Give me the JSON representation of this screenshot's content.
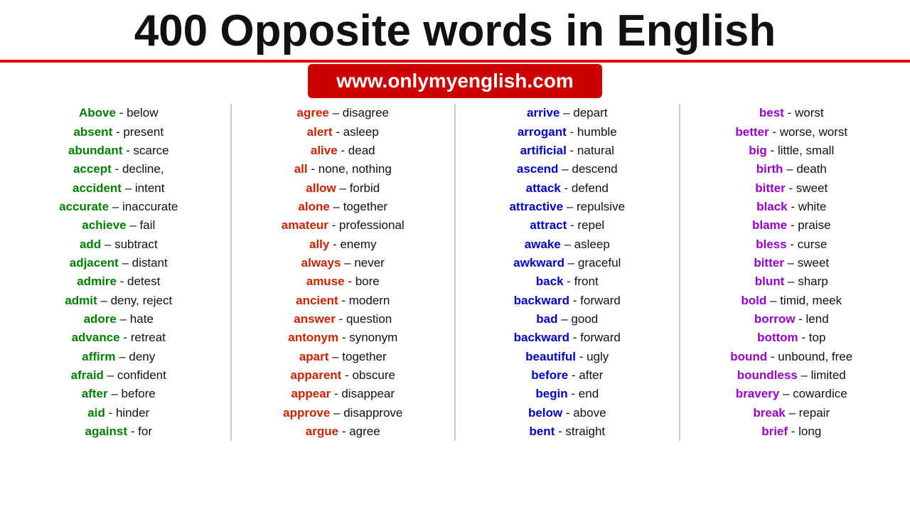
{
  "header": {
    "title": "400 Opposite words in English",
    "url": "www.onlymyenglish.com"
  },
  "columns": [
    {
      "color_class": "col1-key",
      "entries": [
        {
          "key": "Above",
          "sep": " - ",
          "val": "below"
        },
        {
          "key": "absent",
          "sep": " - ",
          "val": "present"
        },
        {
          "key": "abundant",
          "sep": " - ",
          "val": "scarce"
        },
        {
          "key": "accept",
          "sep": " - ",
          "val": "decline,"
        },
        {
          "key": "accident",
          "sep": " – ",
          "val": "intent"
        },
        {
          "key": "accurate",
          "sep": " – ",
          "val": "inaccurate"
        },
        {
          "key": "achieve",
          "sep": " – ",
          "val": "fail"
        },
        {
          "key": "add",
          "sep": " – ",
          "val": "subtract"
        },
        {
          "key": "adjacent",
          "sep": " – ",
          "val": "distant"
        },
        {
          "key": "admire",
          "sep": " - ",
          "val": "detest"
        },
        {
          "key": "admit",
          "sep": " – ",
          "val": "deny, reject"
        },
        {
          "key": "adore",
          "sep": " – ",
          "val": "hate"
        },
        {
          "key": "advance",
          "sep": " - ",
          "val": "retreat"
        },
        {
          "key": "affirm",
          "sep": " – ",
          "val": "deny"
        },
        {
          "key": "afraid",
          "sep": " – ",
          "val": "confident"
        },
        {
          "key": "after",
          "sep": " – ",
          "val": "before"
        },
        {
          "key": "aid",
          "sep": " - ",
          "val": "hinder"
        },
        {
          "key": "against",
          "sep": " - ",
          "val": "for"
        }
      ]
    },
    {
      "color_class": "col2-key",
      "entries": [
        {
          "key": "agree",
          "sep": " – ",
          "val": "disagree"
        },
        {
          "key": "alert",
          "sep": " - ",
          "val": "asleep"
        },
        {
          "key": "alive",
          "sep": " - ",
          "val": "dead"
        },
        {
          "key": "all",
          "sep": " - ",
          "val": "none, nothing"
        },
        {
          "key": "allow",
          "sep": " – ",
          "val": "forbid"
        },
        {
          "key": "alone",
          "sep": " – ",
          "val": "together"
        },
        {
          "key": "amateur",
          "sep": " - ",
          "val": "professional"
        },
        {
          "key": "ally",
          "sep": " - ",
          "val": "enemy"
        },
        {
          "key": "always",
          "sep": " – ",
          "val": "never"
        },
        {
          "key": "amuse",
          "sep": " - ",
          "val": "bore"
        },
        {
          "key": "ancient",
          "sep": " - ",
          "val": "modern"
        },
        {
          "key": "answer",
          "sep": " - ",
          "val": "question"
        },
        {
          "key": "antonym",
          "sep": " - ",
          "val": "synonym"
        },
        {
          "key": "apart",
          "sep": " – ",
          "val": "together"
        },
        {
          "key": "apparent",
          "sep": " - ",
          "val": "obscure"
        },
        {
          "key": "appear",
          "sep": " - ",
          "val": "disappear"
        },
        {
          "key": "approve",
          "sep": " – ",
          "val": "disapprove"
        },
        {
          "key": "argue",
          "sep": " - ",
          "val": "agree"
        }
      ]
    },
    {
      "color_class": "col3-key",
      "entries": [
        {
          "key": "arrive",
          "sep": " – ",
          "val": "depart"
        },
        {
          "key": "arrogant",
          "sep": " - ",
          "val": "humble"
        },
        {
          "key": "artificial",
          "sep": " - ",
          "val": "natural"
        },
        {
          "key": "ascend",
          "sep": " – ",
          "val": "descend"
        },
        {
          "key": "attack",
          "sep": " - ",
          "val": "defend"
        },
        {
          "key": "attractive",
          "sep": " – ",
          "val": "repulsive"
        },
        {
          "key": "attract",
          "sep": " - ",
          "val": "repel"
        },
        {
          "key": "awake",
          "sep": " – ",
          "val": "asleep"
        },
        {
          "key": "awkward",
          "sep": " – ",
          "val": "graceful"
        },
        {
          "key": "back",
          "sep": " - ",
          "val": "front"
        },
        {
          "key": "backward",
          "sep": " - ",
          "val": "forward"
        },
        {
          "key": "bad",
          "sep": " – ",
          "val": "good"
        },
        {
          "key": "backward",
          "sep": " - ",
          "val": "forward"
        },
        {
          "key": "beautiful",
          "sep": " - ",
          "val": "ugly"
        },
        {
          "key": "before",
          "sep": " - ",
          "val": "after"
        },
        {
          "key": "begin",
          "sep": " - ",
          "val": "end"
        },
        {
          "key": "below",
          "sep": " - ",
          "val": "above"
        },
        {
          "key": "bent",
          "sep": " - ",
          "val": "straight"
        }
      ]
    },
    {
      "color_class": "col4-key",
      "entries": [
        {
          "key": "best",
          "sep": " - ",
          "val": "worst"
        },
        {
          "key": "better",
          "sep": " - ",
          "val": "worse, worst"
        },
        {
          "key": "big",
          "sep": " - ",
          "val": "little, small"
        },
        {
          "key": "birth",
          "sep": " – ",
          "val": "death"
        },
        {
          "key": "bitter",
          "sep": " - ",
          "val": "sweet"
        },
        {
          "key": "black",
          "sep": " - ",
          "val": "white"
        },
        {
          "key": "blame",
          "sep": " - ",
          "val": "praise"
        },
        {
          "key": "bless",
          "sep": " - ",
          "val": "curse"
        },
        {
          "key": "bitter",
          "sep": " – ",
          "val": "sweet"
        },
        {
          "key": "blunt",
          "sep": " – ",
          "val": "sharp"
        },
        {
          "key": "bold",
          "sep": " – ",
          "val": "timid, meek"
        },
        {
          "key": "borrow",
          "sep": " - ",
          "val": "lend"
        },
        {
          "key": "bottom",
          "sep": " - ",
          "val": "top"
        },
        {
          "key": "bound",
          "sep": " - ",
          "val": "unbound, free"
        },
        {
          "key": "boundless",
          "sep": " – ",
          "val": "limited"
        },
        {
          "key": "bravery",
          "sep": " – ",
          "val": "cowardice"
        },
        {
          "key": "break",
          "sep": " – ",
          "val": "repair"
        },
        {
          "key": "brief",
          "sep": " - ",
          "val": "long"
        }
      ]
    }
  ]
}
